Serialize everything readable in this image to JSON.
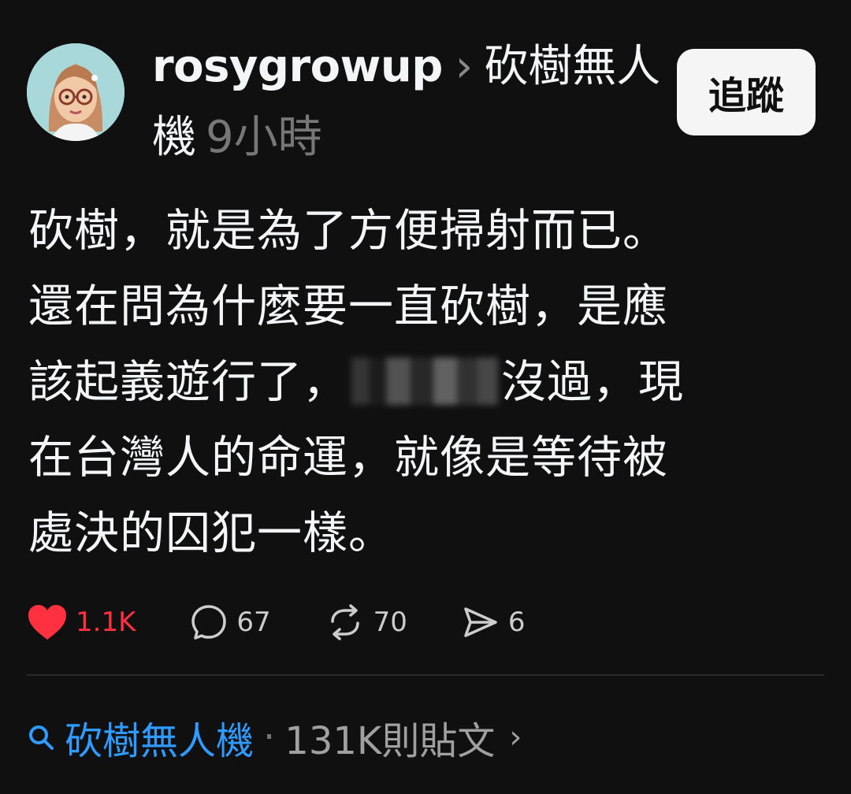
{
  "header": {
    "username": "rosygrowup",
    "separator": "›",
    "topic": "砍樹無人機",
    "timestamp": "9小時",
    "follow_label": "追蹤"
  },
  "post": {
    "lines": [
      "砍樹，就是為了方便掃射而已。",
      "還在問為什麼要一直砍樹，是應",
      "該起義遊行了，",
      "沒過，現",
      "在台灣人的命運，就像是等待被",
      "處決的囚犯一樣。"
    ]
  },
  "actions": {
    "likes": "1.1K",
    "comments": "67",
    "reposts": "70",
    "shares": "6"
  },
  "footer": {
    "topic": "砍樹無人機",
    "dot": "·",
    "post_count": "131K則貼文",
    "arrow": "›"
  },
  "colors": {
    "background": "#101010",
    "text": "#f3f5f7",
    "muted": "#777777",
    "like": "#ff3040",
    "link": "#2f9bff",
    "follow_bg": "#f5f5f5"
  },
  "icons": {
    "like": "heart-icon",
    "comment": "comment-bubble-icon",
    "repost": "repost-icon",
    "share": "send-icon",
    "search": "search-icon",
    "chevron": "chevron-right-icon"
  }
}
